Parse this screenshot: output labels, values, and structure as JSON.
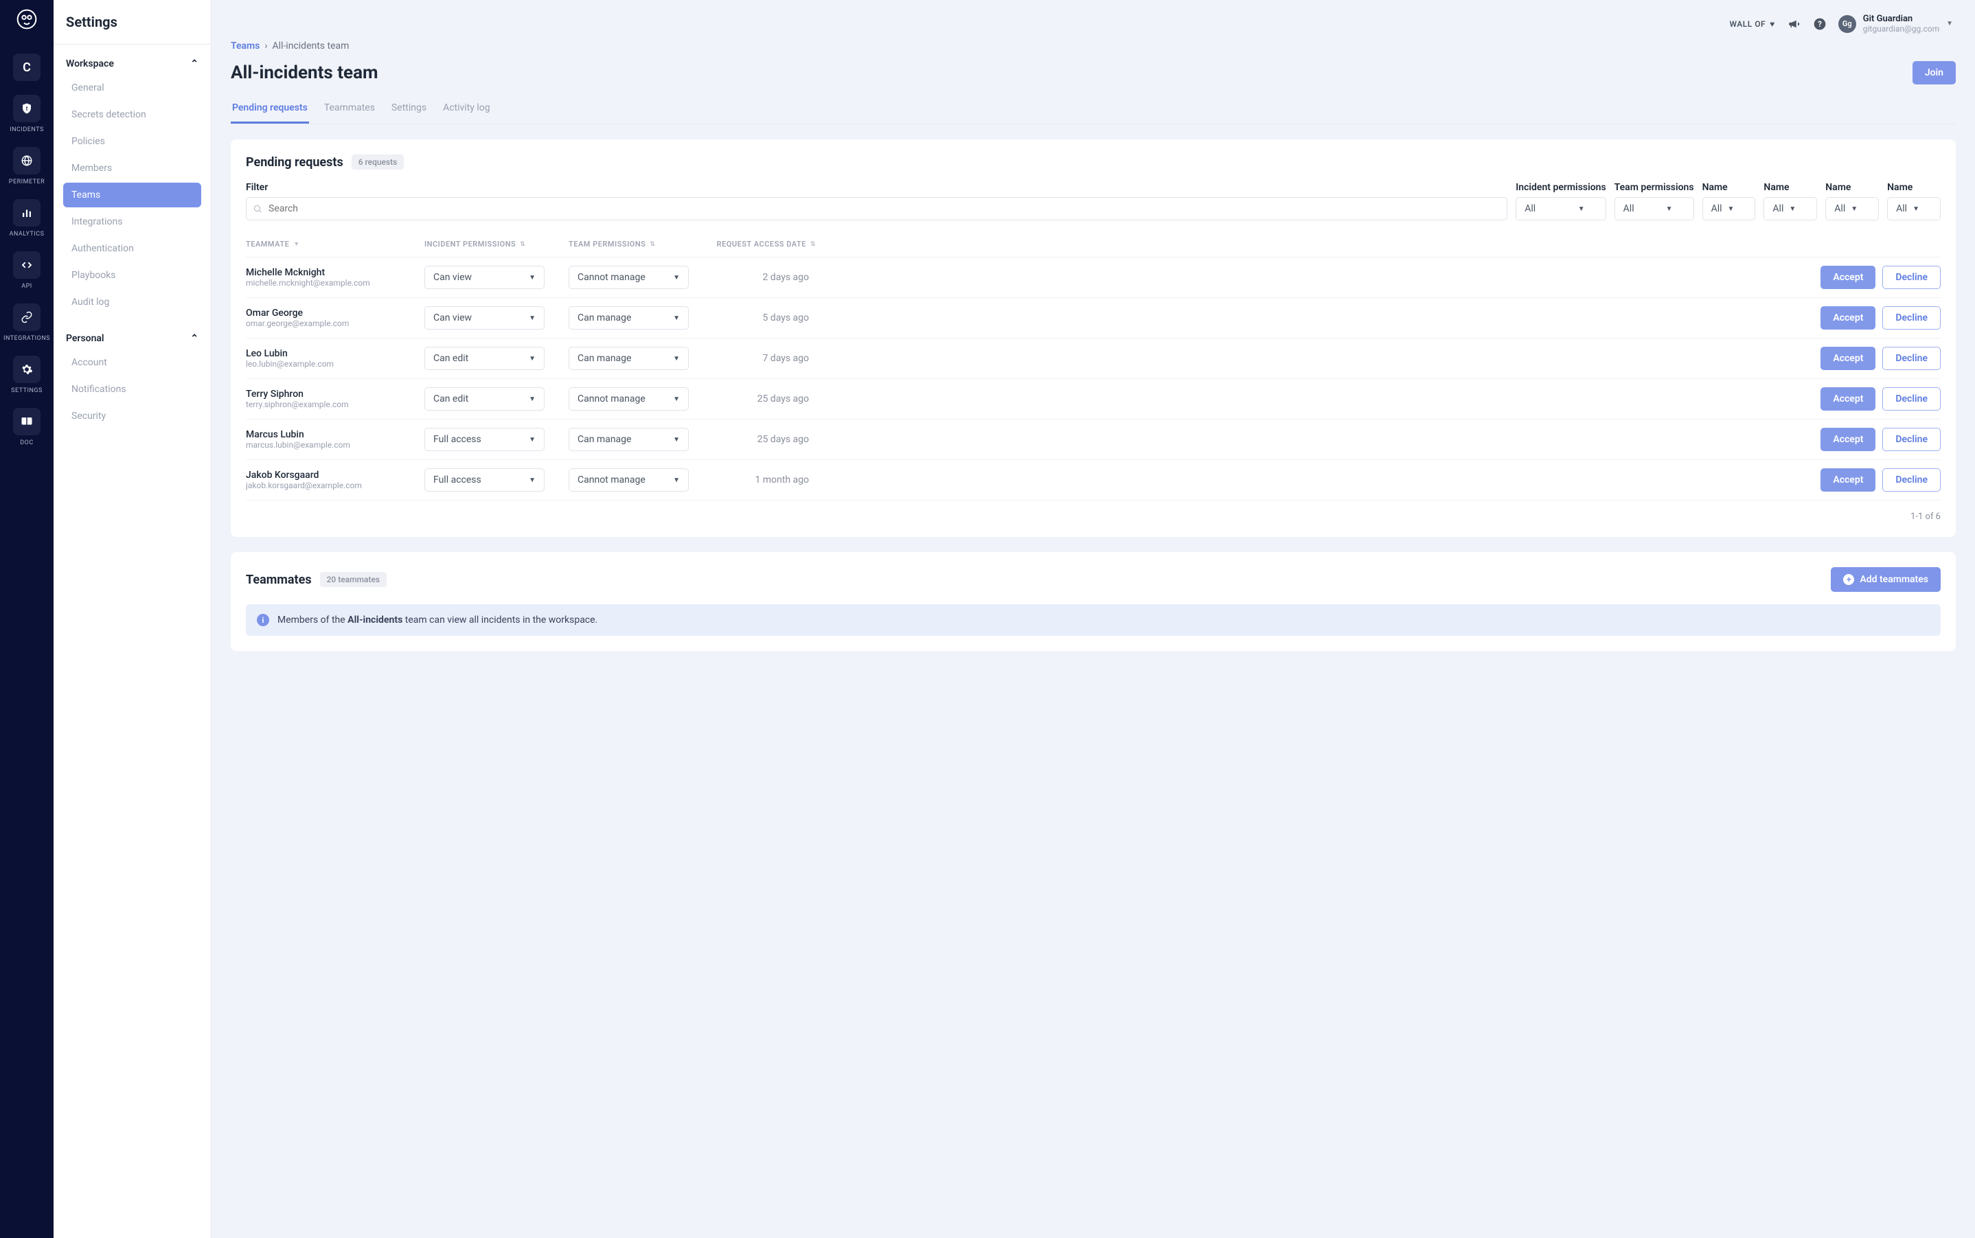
{
  "topbar": {
    "wallof": "WALL OF",
    "user_name": "Git Guardian",
    "user_email": "gitguardian@gg.com",
    "avatar": "Gg"
  },
  "nav": {
    "c": "C",
    "incidents": "INCIDENTS",
    "perimeter": "PERIMETER",
    "analytics": "ANALYTICS",
    "api": "API",
    "integrations": "INTEGRATIONS",
    "settings": "SETTINGS",
    "doc": "DOC"
  },
  "settings": {
    "title": "Settings",
    "workspace": "Workspace",
    "personal": "Personal",
    "workspace_items": [
      "General",
      "Secrets detection",
      "Policies",
      "Members",
      "Teams",
      "Integrations",
      "Authentication",
      "Playbooks",
      "Audit log"
    ],
    "personal_items": [
      "Account",
      "Notifications",
      "Security"
    ]
  },
  "breadcrumb": {
    "root": "Teams",
    "current": "All-incidents team"
  },
  "page": {
    "title": "All-incidents team",
    "join": "Join"
  },
  "tabs": [
    "Pending requests",
    "Teammates",
    "Settings",
    "Activity log"
  ],
  "pending": {
    "title": "Pending requests",
    "count_pill": "6 requests",
    "filter_labels": {
      "filter": "Filter",
      "incident": "Incident permissions",
      "team": "Team permissions",
      "name1": "Name",
      "name2": "Name",
      "name3": "Name",
      "name4": "Name"
    },
    "search_placeholder": "Search",
    "all": "All",
    "columns": {
      "teammate": "TEAMMATE",
      "incident_perm": "INCIDENT PERMISSIONS",
      "team_perm": "TEAM PERMISSIONS",
      "request_date": "REQUEST ACCESS DATE"
    },
    "accept": "Accept",
    "decline": "Decline",
    "rows": [
      {
        "name": "Michelle Mcknight",
        "email": "michelle.mcknight@example.com",
        "incident": "Can view",
        "team": "Cannot manage",
        "date": "2 days ago"
      },
      {
        "name": "Omar George",
        "email": "omar.george@example.com",
        "incident": "Can view",
        "team": "Can manage",
        "date": "5 days ago"
      },
      {
        "name": "Leo Lubin",
        "email": "leo.lubin@example.com",
        "incident": "Can edit",
        "team": "Can manage",
        "date": "7 days ago"
      },
      {
        "name": "Terry Siphron",
        "email": "terry.siphron@example.com",
        "incident": "Can edit",
        "team": "Cannot manage",
        "date": "25 days ago"
      },
      {
        "name": "Marcus Lubin",
        "email": "marcus.lubin@example.com",
        "incident": "Full access",
        "team": "Can manage",
        "date": "25 days ago"
      },
      {
        "name": "Jakob Korsgaard",
        "email": "jakob.korsgaard@example.com",
        "incident": "Full access",
        "team": "Cannot manage",
        "date": "1 month ago"
      }
    ],
    "pagination": "1-1 of 6"
  },
  "teammates": {
    "title": "Teammates",
    "count_pill": "20 teammates",
    "add_button": "Add teammates",
    "banner_pre": "Members of the ",
    "banner_strong": "All-incidents",
    "banner_post": " team can view all incidents in the workspace."
  }
}
